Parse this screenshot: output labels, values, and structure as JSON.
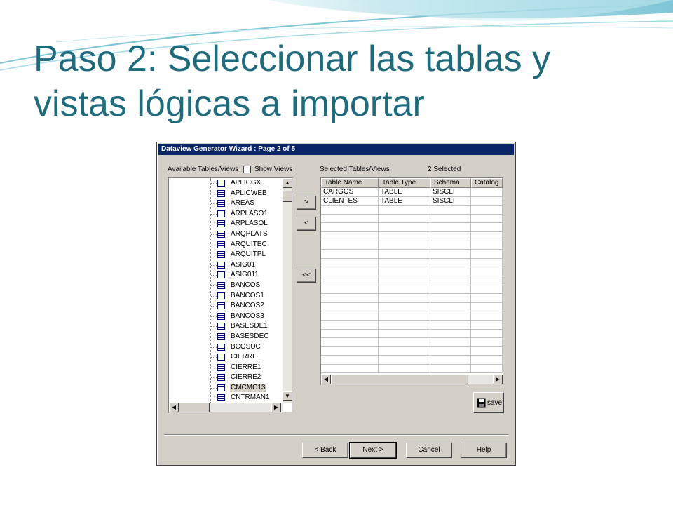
{
  "slide": {
    "title_line1": "Paso 2: Seleccionar las tablas y",
    "title_line2": "vistas lógicas a importar"
  },
  "dialog": {
    "title": "Dataview Generator Wizard : Page 2 of 5",
    "available_label": "Available Tables/Views",
    "show_views_label": "Show Views",
    "selected_label": "Selected Tables/Views",
    "selected_count": "2 Selected",
    "tables": [
      "APLICGX",
      "APLICWEB",
      "AREAS",
      "ARPLASO1",
      "ARPLASOL",
      "ARQPLATS",
      "ARQUITEC",
      "ARQUITPL",
      "ASIG01",
      "ASIG011",
      "BANCOS",
      "BANCOS1",
      "BANCOS2",
      "BANCOS3",
      "BASESDE1",
      "BASESDEC",
      "BCOSUC",
      "CIERRE",
      "CIERRE1",
      "CIERRE2",
      "CMCMC13",
      "CNTRMAN1"
    ],
    "selected_table_index": 20,
    "move_buttons": {
      "add": ">",
      "remove": "<",
      "remove_all": "<<"
    },
    "grid": {
      "columns": [
        "Table Name",
        "Table Type",
        "Schema",
        "Catalog"
      ],
      "rows": [
        [
          "CARGOS",
          "TABLE",
          "SISCLI",
          ""
        ],
        [
          "CLIENTES",
          "TABLE",
          "SISCLI",
          ""
        ]
      ]
    },
    "save_label": "save",
    "buttons": {
      "back": "< Back",
      "next": "Next >",
      "cancel": "Cancel",
      "help": "Help"
    }
  },
  "colors": {
    "title": "#1f6b7e",
    "titlebar": "#0a246a",
    "face": "#d4d0c8"
  }
}
